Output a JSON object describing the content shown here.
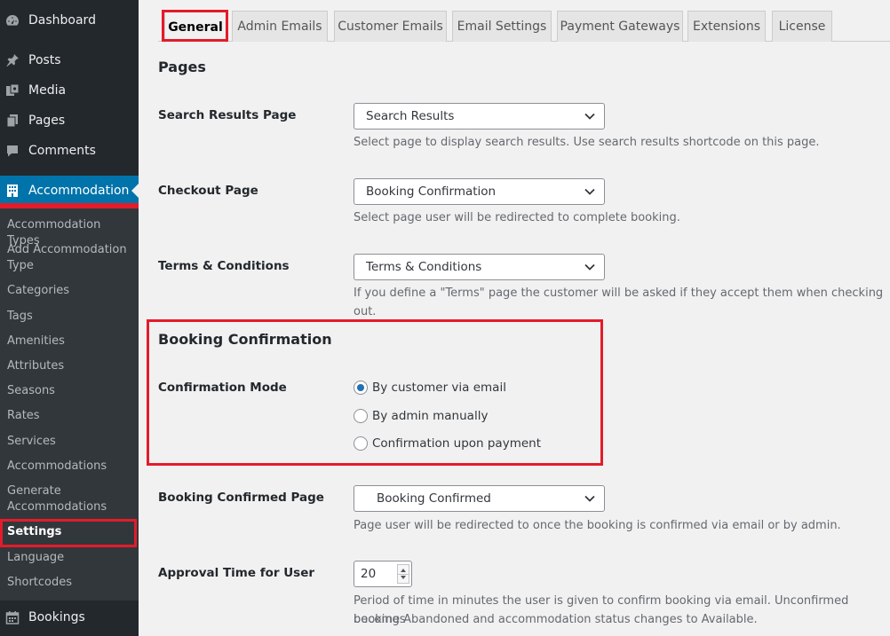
{
  "sidebar": {
    "top_items": [
      {
        "label": "Dashboard",
        "icon": "dashboard-icon"
      },
      {
        "label": "Posts",
        "icon": "pushpin-icon"
      },
      {
        "label": "Media",
        "icon": "media-icon"
      },
      {
        "label": "Pages",
        "icon": "pages-icon"
      },
      {
        "label": "Comments",
        "icon": "comments-icon"
      },
      {
        "label": "Accommodation",
        "icon": "building-icon",
        "current": true
      }
    ],
    "submenu": [
      "Accommodation Types",
      "Add Accommodation Type",
      "Categories",
      "Tags",
      "Amenities",
      "Attributes",
      "Seasons",
      "Rates",
      "Services",
      "Accommodations",
      "Generate Accommodations",
      "Settings",
      "Language",
      "Shortcodes"
    ],
    "submenu_current": "Settings",
    "bottom_item": {
      "label": "Bookings",
      "icon": "calendar-icon"
    }
  },
  "tabs": [
    "General",
    "Admin Emails",
    "Customer Emails",
    "Email Settings",
    "Payment Gateways",
    "Extensions",
    "License"
  ],
  "active_tab": "General",
  "pages_section": {
    "title": "Pages",
    "fields": [
      {
        "label": "Search Results Page",
        "value": "Search Results",
        "description": "Select page to display search results. Use search results shortcode on this page."
      },
      {
        "label": "Checkout Page",
        "value": "Booking Confirmation",
        "description": "Select page user will be redirected to complete booking."
      },
      {
        "label": "Terms & Conditions",
        "value": "Terms & Conditions",
        "description": "If you define a \"Terms\" page the customer will be asked if they accept them when checking out."
      }
    ]
  },
  "booking_confirmation": {
    "title": "Booking Confirmation",
    "mode_label": "Confirmation Mode",
    "options": [
      {
        "label": "By customer via email",
        "checked": true
      },
      {
        "label": "By admin manually",
        "checked": false
      },
      {
        "label": "Confirmation upon payment",
        "checked": false
      }
    ],
    "confirmed_page": {
      "label": "Booking Confirmed Page",
      "value": "Booking Confirmed",
      "description": "Page user will be redirected to once the booking is confirmed via email or by admin."
    },
    "approval_time": {
      "label": "Approval Time for User",
      "value": "20",
      "description_line1": "Period of time in minutes the user is given to confirm booking via email. Unconfirmed bookings",
      "description_line2": "become Abandoned and accommodation status changes to Available."
    }
  },
  "colors": {
    "highlight": "#e41b2a",
    "accent": "#0073aa",
    "sidebar_bg": "#23282d",
    "submenu_bg": "#32373c"
  }
}
